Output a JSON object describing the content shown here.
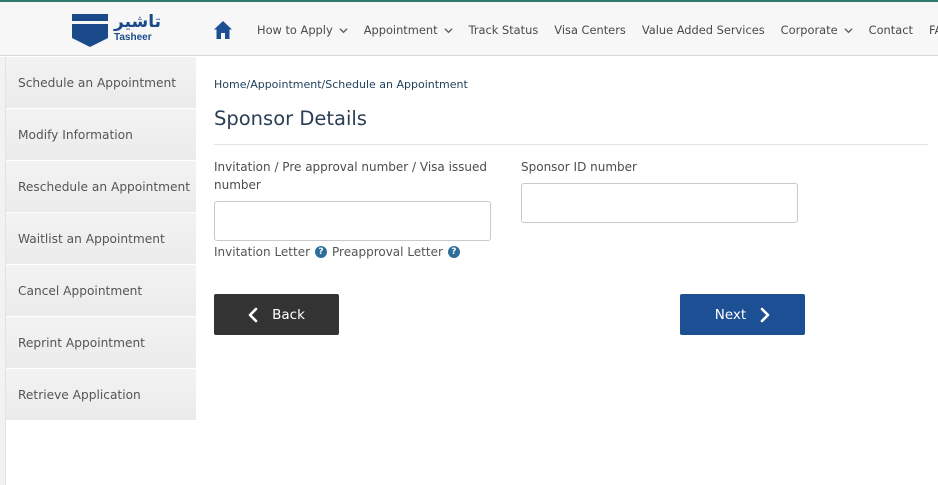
{
  "header": {
    "logo_arabic": "تاشير",
    "logo_english": "Tasheer",
    "home_icon": "home-icon",
    "nav": [
      {
        "label": "How to Apply",
        "has_dropdown": true
      },
      {
        "label": "Appointment",
        "has_dropdown": true
      },
      {
        "label": "Track Status",
        "has_dropdown": false
      },
      {
        "label": "Visa Centers",
        "has_dropdown": false
      },
      {
        "label": "Value Added Services",
        "has_dropdown": false
      },
      {
        "label": "Corporate",
        "has_dropdown": true
      },
      {
        "label": "Contact",
        "has_dropdown": false
      },
      {
        "label": "FAQ",
        "has_dropdown": false
      }
    ]
  },
  "sidebar": {
    "items": [
      {
        "label": "Schedule an Appointment"
      },
      {
        "label": "Modify Information"
      },
      {
        "label": "Reschedule an Appointment"
      },
      {
        "label": "Waitlist an Appointment"
      },
      {
        "label": "Cancel Appointment"
      },
      {
        "label": "Reprint Appointment"
      },
      {
        "label": "Retrieve Application"
      }
    ]
  },
  "main": {
    "breadcrumb": "Home/Appointment/Schedule an Appointment",
    "title": "Sponsor Details",
    "field1": {
      "label": "Invitation / Pre approval number / Visa issued number",
      "value": "",
      "placeholder": ""
    },
    "field2": {
      "label": "Sponsor ID number",
      "value": "",
      "placeholder": ""
    },
    "invitation_letter": "Invitation Letter",
    "preapproval_letter": "Preapproval Letter",
    "help_glyph": "?",
    "back_label": "Back",
    "next_label": "Next"
  },
  "colors": {
    "brand_blue": "#1c4f93",
    "back_button": "#333333",
    "help_icon": "#2d6e9a",
    "header_accent": "#2f7a6e"
  }
}
